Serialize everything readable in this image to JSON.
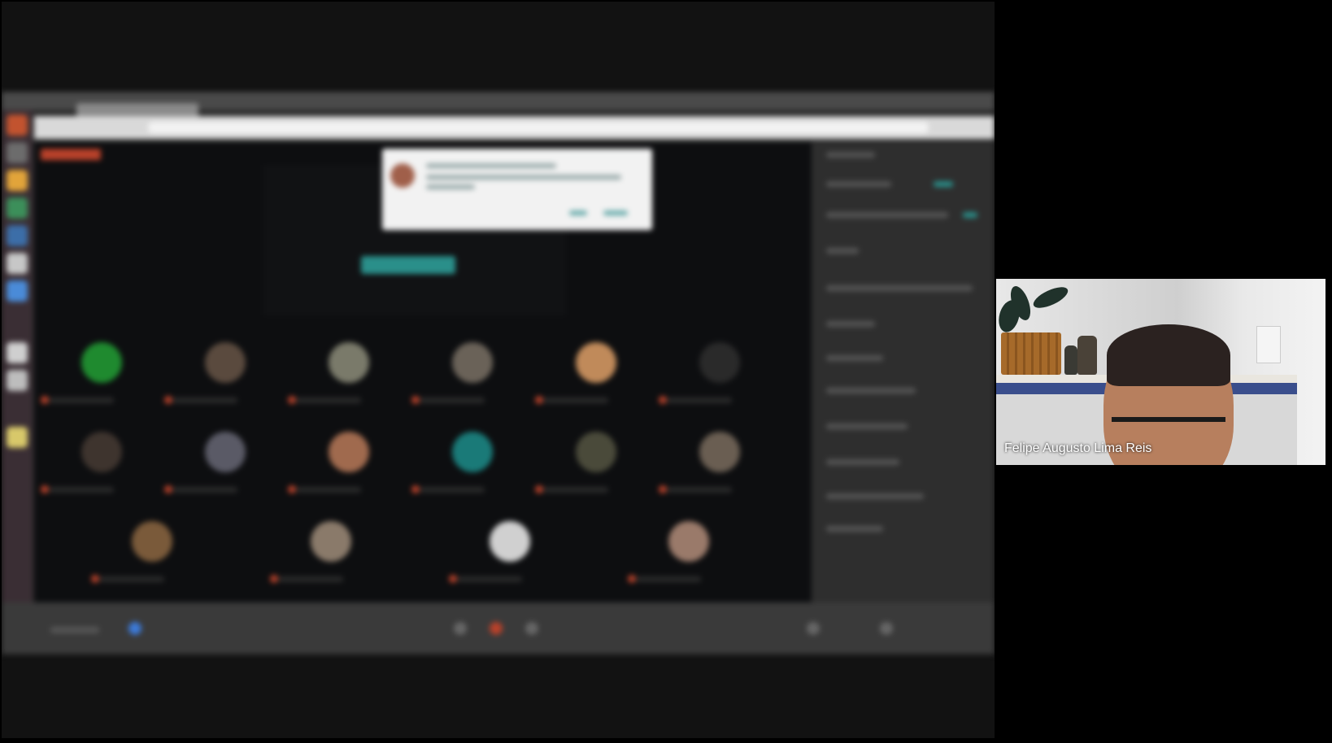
{
  "participant_video": {
    "name": "Felipe Augusto Lima Reis"
  },
  "shared_screen": {
    "description_hidden": true
  },
  "colors": {
    "background": "#000000",
    "main_area": "#121212",
    "accent": "#b8412a",
    "teal": "#2a8f8a"
  }
}
